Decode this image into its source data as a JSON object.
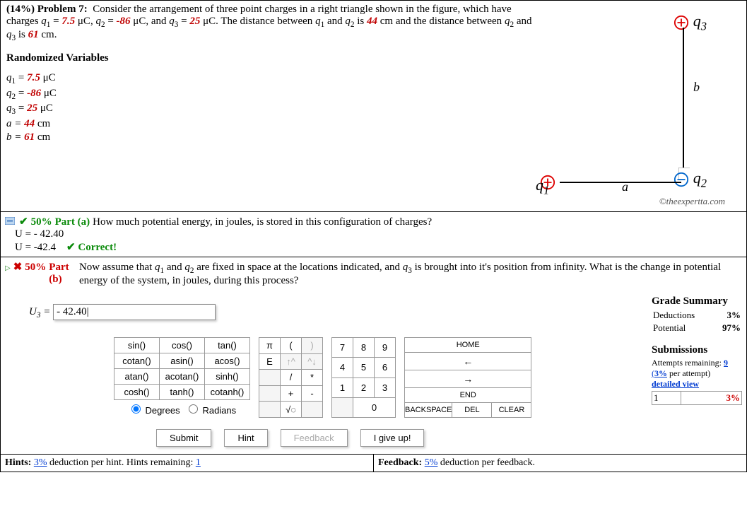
{
  "problem": {
    "weight_pct": "(14%)",
    "label": "Problem 7:",
    "text_intro": "Consider the arrangement of three point charges in a right triangle shown in the figure, which have charges ",
    "q1_label": "q",
    "q1_sub": "1",
    "q1_eq": " = ",
    "q1_val": "7.5",
    "q1_unit": " μC, ",
    "q2_label": "q",
    "q2_sub": "2",
    "q2_eq": " = ",
    "q2_val": "-86",
    "q2_unit": " μC, and ",
    "q3_label": "q",
    "q3_sub": "3",
    "q3_eq": " = ",
    "q3_val": "25",
    "q3_unit": " μC. The distance between ",
    "dist1": "q",
    "dist1_sub": "1",
    "and1": " and ",
    "dist2": "q",
    "dist2_sub": "2",
    "is1": " is ",
    "a_val": "44",
    "a_unit": " cm and the distance between ",
    "dist3": "q",
    "dist3_sub": "2",
    "and2": " and ",
    "dist4": "q",
    "dist4_sub": "3",
    "is2": " is ",
    "b_val": "61",
    "b_unit": " cm.",
    "randvar_head": "Randomized Variables",
    "variables": {
      "line1_l": "q",
      "line1_s": "1",
      "line1_eq": " = ",
      "line1_v": "7.5",
      "line1_u": " μC",
      "line2_l": "q",
      "line2_s": "2",
      "line2_eq": " = ",
      "line2_v": "-86",
      "line2_u": " μC",
      "line3_l": "q",
      "line3_s": "3",
      "line3_eq": " = ",
      "line3_v": "25",
      "line3_u": " μC",
      "line4_l": "a = ",
      "line4_v": "44",
      "line4_u": " cm",
      "line5_l": "b = ",
      "line5_v": "61",
      "line5_u": " cm"
    },
    "figure": {
      "q1_label": "q",
      "q1_sub": "1",
      "q2_label": "q",
      "q2_sub": "2",
      "q3_label": "q",
      "q3_sub": "3",
      "side_a": "a",
      "side_b": "b",
      "copyright": "©theexpertta.com"
    }
  },
  "part_a": {
    "weight": "50%",
    "title_bold": "Part (a)",
    "question": "How much potential energy, in joules, is stored in this configuration of charges?",
    "line1": "U = - 42.40",
    "line2_prefix": "U = -42.4",
    "correct_label": "Correct!"
  },
  "part_b": {
    "weight": "50%",
    "title_bold": "Part (b)",
    "question_1": "Now assume that ",
    "q1": "q",
    "q1_sub": "1",
    "q_and1": " and ",
    "q2": "q",
    "q2_sub": "2",
    "q_fixed": " are fixed in space at the locations indicated, and ",
    "q3": "q",
    "q3_sub": "3",
    "q_brought": " is brought into it's position from infinity. What is the change in potential energy of the system, in joules, during this process?",
    "answer_prefix_l": "U",
    "answer_prefix_s": "3",
    "answer_prefix_eq": " = ",
    "answer_value": "- 42.40|"
  },
  "side": {
    "grade_head": "Grade Summary",
    "deductions_l": "Deductions",
    "deductions_v": "3%",
    "potential_l": "Potential",
    "potential_v": "97%",
    "subs_head": "Submissions",
    "attempts_l": "Attempts remaining: ",
    "attempts_v": "9",
    "per_attempt": "(3% per attempt)",
    "detailed": "detailed view",
    "row1_l": "1",
    "row1_v": "3%"
  },
  "keypad_fn": [
    [
      "sin()",
      "cos()",
      "tan()"
    ],
    [
      "cotan()",
      "asin()",
      "acos()"
    ],
    [
      "atan()",
      "acotan()",
      "sinh()"
    ],
    [
      "cosh()",
      "tanh()",
      "cotanh()"
    ]
  ],
  "keypad_radio": {
    "deg": "Degrees",
    "rad": "Radians"
  },
  "keypad_sym": [
    [
      "π",
      "(",
      ")"
    ],
    [
      "E",
      "↑^",
      "^↓"
    ],
    [
      "",
      "/",
      "*"
    ],
    [
      "",
      "+",
      "-"
    ],
    [
      "",
      "√◌",
      ""
    ]
  ],
  "keypad_num": [
    [
      "7",
      "8",
      "9"
    ],
    [
      "4",
      "5",
      "6"
    ],
    [
      "1",
      "2",
      "3"
    ],
    [
      "",
      "0",
      ""
    ]
  ],
  "keypad_nav": [
    [
      "HOME"
    ],
    [
      "←"
    ],
    [
      "→"
    ],
    [
      "END"
    ],
    [
      "BACKSPACE",
      "DEL",
      "CLEAR"
    ]
  ],
  "nav_row1": "HOME",
  "nav_row2": "←",
  "nav_row3": "→",
  "nav_row4": "END",
  "nav_row5a": "BACKSPACE",
  "nav_row5b": "DEL",
  "nav_row5c": "CLEAR",
  "actions": {
    "submit": "Submit",
    "hint": "Hint",
    "feedback": "Feedback",
    "giveup": "I give up!"
  },
  "hints": {
    "left_pre": "Hints: ",
    "left_pct": "3%",
    "left_mid": " deduction per hint. Hints remaining: ",
    "left_n": "1",
    "right_pre": "Feedback: ",
    "right_pct": "5%",
    "right_mid": " deduction per feedback."
  }
}
